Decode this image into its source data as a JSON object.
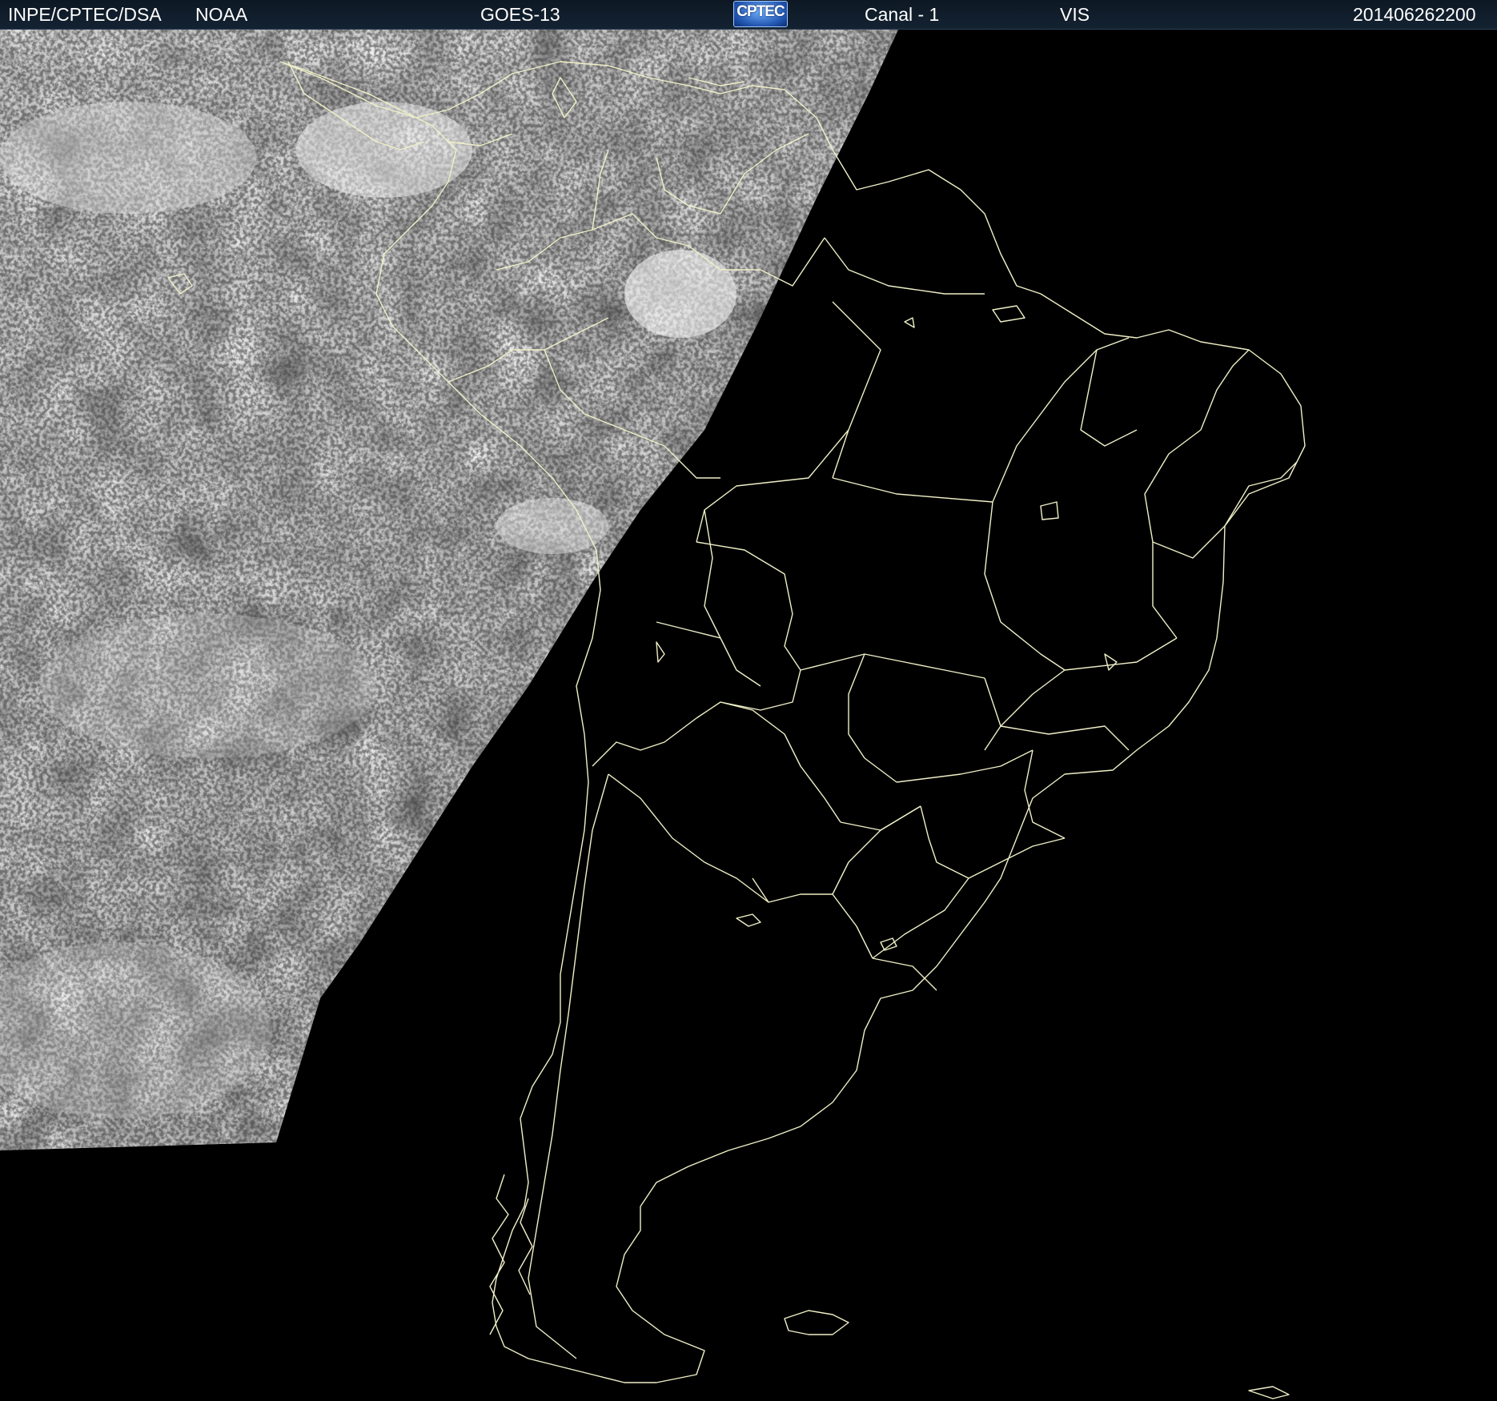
{
  "header": {
    "institution": "INPE/CPTEC/DSA",
    "agency": "NOAA",
    "satellite": "GOES-13",
    "logo_text": "CPTEC",
    "channel": "Canal - 1",
    "band": "VIS",
    "timestamp": "201406262200"
  },
  "map": {
    "projection_extent": "South America",
    "boundary_color": "#f0f0c8",
    "sea_color": "#000000",
    "cloud_gray": "#9a9a9a",
    "illuminated_region": "west (day side)",
    "night_region": "east (terminator beyond)"
  },
  "colors": {
    "header_bg": "#132232",
    "header_text": "#ffffff",
    "logo_blue": "#1d4fa8"
  }
}
